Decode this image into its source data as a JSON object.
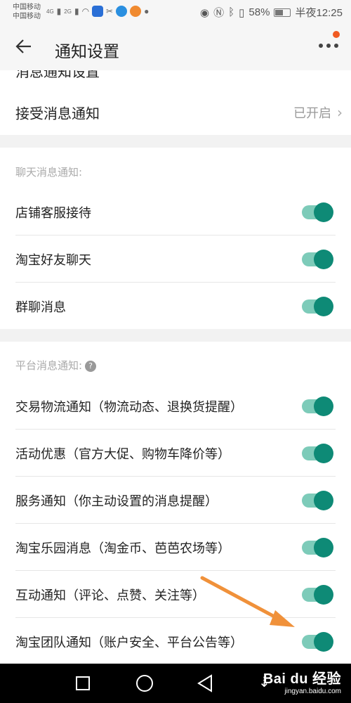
{
  "status_bar": {
    "carrier_1": "中国移动",
    "carrier_2": "中国移动",
    "signal_1": "4G",
    "signal_2": "2G",
    "battery": "58%",
    "battery_level": 0.58,
    "time": "半夜12:25"
  },
  "header": {
    "title": "通知设置"
  },
  "partial_row": {
    "label": "消息通知设置"
  },
  "accept_row": {
    "label": "接受消息通知",
    "value": "已开启"
  },
  "chat_section": {
    "title": "聊天消息通知:",
    "items": [
      {
        "label": "店铺客服接待",
        "on": true
      },
      {
        "label": "淘宝好友聊天",
        "on": true
      },
      {
        "label": "群聊消息",
        "on": true
      }
    ]
  },
  "platform_section": {
    "title": "平台消息通知:",
    "help": "?",
    "items": [
      {
        "label": "交易物流通知（物流动态、退换货提醒）",
        "on": true
      },
      {
        "label": "活动优惠（官方大促、购物车降价等）",
        "on": true
      },
      {
        "label": "服务通知（你主动设置的消息提醒）",
        "on": true
      },
      {
        "label": "淘宝乐园消息（淘金币、芭芭农场等）",
        "on": true
      },
      {
        "label": "互动通知（评论、点赞、关注等）",
        "on": true
      },
      {
        "label": "淘宝团队通知（账户安全、平台公告等）",
        "on": true
      }
    ]
  },
  "colors": {
    "toggle_on_track": "#7dcbb9",
    "toggle_on_knob": "#0e8a76",
    "annotation_arrow": "#f0913a",
    "notification_dot": "#f05a22"
  },
  "watermark": {
    "top": "Bai du 经验",
    "bottom": "jingyan.baidu.com"
  }
}
